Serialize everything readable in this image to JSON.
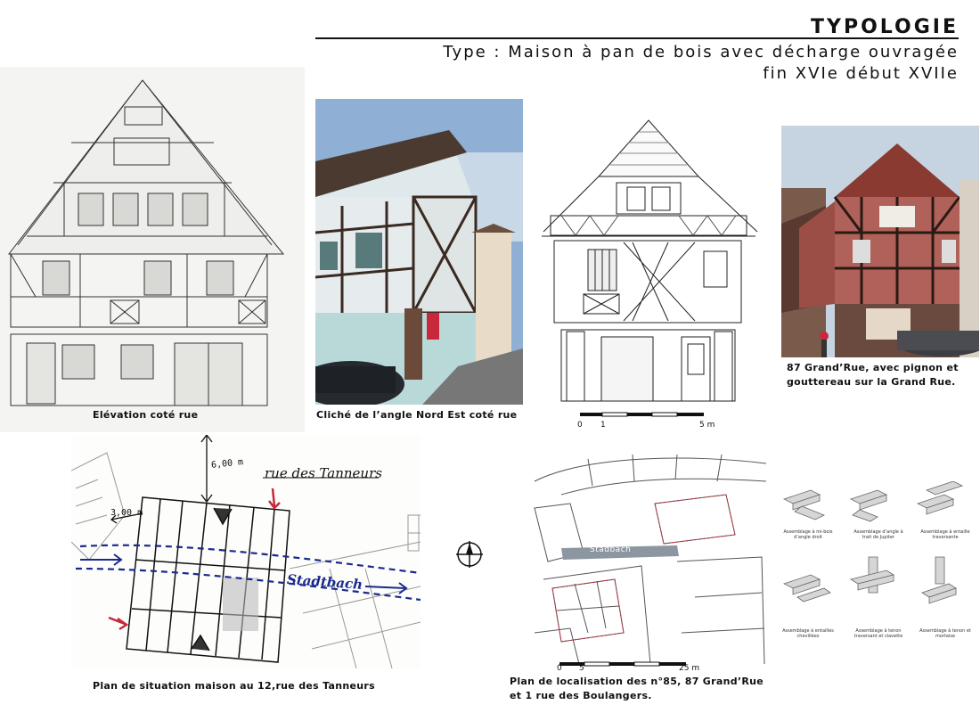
{
  "header": {
    "title": "TYPOLOGIE",
    "type_line": "Type : Maison à pan de bois avec décharge ouvragée",
    "period_line": "fin XVIe début XVIIe"
  },
  "captions": {
    "elevation": "Elévation coté rue",
    "photo_corner": "Cliché de l’angle Nord Est coté rue",
    "photo_grandrue_1": "87 Grand’Rue, avec pignon et",
    "photo_grandrue_2": "gouttereau sur la Grand Rue.",
    "situation_plan": "Plan de situation maison au 12,rue des Tanneurs",
    "localisation_1": "Plan de localisation des n°85, 87 Grand’Rue",
    "localisation_2": "et 1 rue des Boulangers."
  },
  "scale_small": {
    "left": "0",
    "mid": "1",
    "right": "5 m"
  },
  "scale_large": {
    "left": "0",
    "mid": "5",
    "right": "25 m"
  },
  "situation_plan": {
    "street_name": "rue des Tanneurs",
    "stream_name": "Stadtbach",
    "dim_top": "6,00 m",
    "dim_left": "3,00 m"
  },
  "localisation_plan": {
    "stream_name": "Stadbach"
  },
  "joints": {
    "labels": [
      "Assemblage à mi-bois d’angle droit",
      "Assemblage d’angle à trait de Jupiter",
      "Assemblage à entaille traversante",
      "Assemblage à entailles chevillées",
      "Assemblage à tenon traversant et clavette",
      "Assemblage à tenon et mortaise"
    ]
  },
  "colors": {
    "accent_red": "#c8283a",
    "stream_blue": "#1a2a8c",
    "timber_dark": "#3a2418",
    "facade_pink": "#b0625a"
  }
}
